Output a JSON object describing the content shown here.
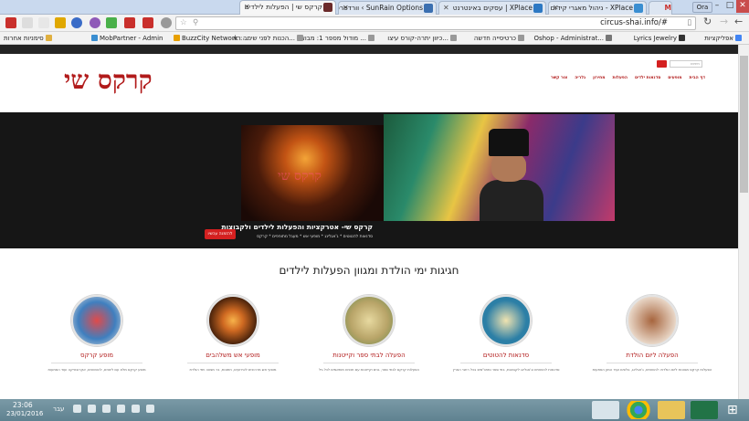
{
  "tabs": [
    {
      "label": "קרקס שי | הפעלות לילדים",
      "active": true,
      "color": "#6b2a2a"
    },
    {
      "label": "SunRain Options › וורדפרס",
      "active": false,
      "color": "#3b6fb0"
    },
    {
      "label": "XPlace | עסקים באינטרנט",
      "active": false,
      "color": "#2d78c3"
    },
    {
      "label": "XPlace - ניהול מאגרי קידום",
      "active": false,
      "color": "#3a8ed1"
    },
    {
      "label": "M",
      "active": false,
      "color": "#c9302c"
    }
  ],
  "window": {
    "user": "Ora",
    "minimize": "–",
    "maximize": "□",
    "close": "✕"
  },
  "address_bar": {
    "url": "circus-shai.info/#"
  },
  "bookmarks": [
    "אפליקציות",
    "Lyrics Jewelry",
    "Oshop - Administrat...",
    "כרטיסייה חדשה",
    "כיוון יתרה-קורס עיצו...",
    "מודול מספר 1: מבוא ...",
    "הכנות לפני שיחה רא...",
    "BuzzCity Network : ...",
    "MobPartner - Admin",
    "סימניות אחרות"
  ],
  "site": {
    "logo": "קרקס שי",
    "search_placeholder": "חיפוש",
    "nav": [
      "דף הבית",
      "מופעים",
      "סדנאות ילדים",
      "הפעלות",
      "מחירון",
      "גלריה",
      "צור קשר"
    ],
    "hero": {
      "caption": "קרקס שי- אטרקציות והפעלות לילדים ולקבוצות",
      "sub": "סדנאות להטוטים * ג'אגלינג * מופעי אש * מעגל מתופפים * קרקס",
      "button": "להזמנה עכשיו",
      "watermark": "קרקס שי"
    },
    "section_title": "חגיגות ימי הולדת ומגוון הפעלות לילדים",
    "cards": [
      {
        "title": "הפעלה ליום הולדת",
        "desc": "הפעלות קרקס מגוונות ליום הולדת: להטוטים, ג'אגלינג, בלונים ועוד המון הפתעות",
        "color": "#a7653e"
      },
      {
        "title": "סדנאות להטוטים",
        "desc": "סדנאות להטוטים וג'אגלינג לקבוצות, בתי ספר ומתנ\"סים בכל רחבי הארץ",
        "color": "#2c7fa6"
      },
      {
        "title": "הפעלה לבתי ספר וקייטנות",
        "desc": "הפעלות קרקס לבתי ספר, גנים וקייטנות עם תכנים מותאמים לכל גיל",
        "color": "#b8a468"
      },
      {
        "title": "מופעי אש משלהבים",
        "desc": "מופעי אש מרהיבים לאירועים, חתונות, בר מצווה וימי הולדת",
        "color": "#d06a22"
      },
      {
        "title": "מופע קרקס",
        "desc": "מופע קרקס מלא עם ליצנים, להטוטנים, אקרובטיקה ועוד הפתעות",
        "color": "#3f7fbf"
      }
    ]
  },
  "taskbar": {
    "time": "23:06",
    "date": "23/01/2016",
    "lang": "עבר"
  }
}
